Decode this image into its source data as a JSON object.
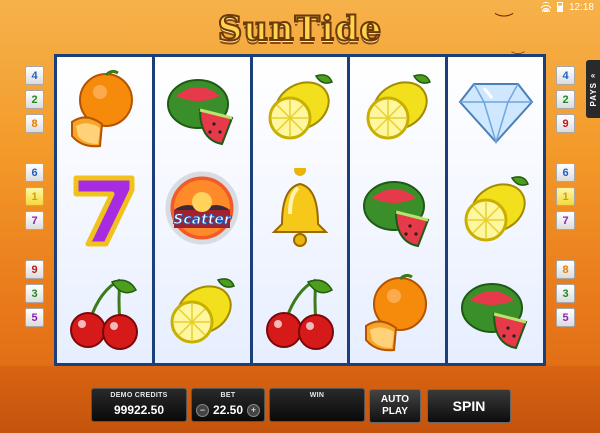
{
  "status": {
    "time": "12:18"
  },
  "logo": {
    "text": "SunTide"
  },
  "paylines": {
    "left": [
      {
        "n": "4",
        "color": "blue"
      },
      {
        "n": "2",
        "color": "green"
      },
      {
        "n": "8",
        "color": "orange"
      },
      {
        "n": "6",
        "color": "blue"
      },
      {
        "n": "1",
        "color": "yellow"
      },
      {
        "n": "7",
        "color": "purple"
      },
      {
        "n": "9",
        "color": "red"
      },
      {
        "n": "3",
        "color": "green"
      },
      {
        "n": "5",
        "color": "purple"
      }
    ],
    "right": [
      {
        "n": "4",
        "color": "blue"
      },
      {
        "n": "2",
        "color": "green"
      },
      {
        "n": "9",
        "color": "red"
      },
      {
        "n": "6",
        "color": "blue"
      },
      {
        "n": "1",
        "color": "yellow"
      },
      {
        "n": "7",
        "color": "purple"
      },
      {
        "n": "8",
        "color": "orange"
      },
      {
        "n": "3",
        "color": "green"
      },
      {
        "n": "5",
        "color": "purple"
      }
    ]
  },
  "pays_tab": {
    "label": "PAYS",
    "arrow": "«"
  },
  "reels": [
    [
      "orange",
      "seven",
      "cherries"
    ],
    [
      "watermelon",
      "scatter",
      "lemon"
    ],
    [
      "lemon",
      "bell",
      "cherries"
    ],
    [
      "lemon",
      "watermelon",
      "orange"
    ],
    [
      "diamond",
      "lemon",
      "watermelon"
    ]
  ],
  "scatter_text": "Scatter",
  "controls": {
    "credits_label": "DEMO CREDITS",
    "credits_value": "99922.50",
    "bet_label": "BET",
    "bet_value": "22.50",
    "bet_minus": "−",
    "bet_plus": "+",
    "win_label": "WIN",
    "win_value": "",
    "auto_play": "AUTO PLAY",
    "spin": "SPIN"
  }
}
